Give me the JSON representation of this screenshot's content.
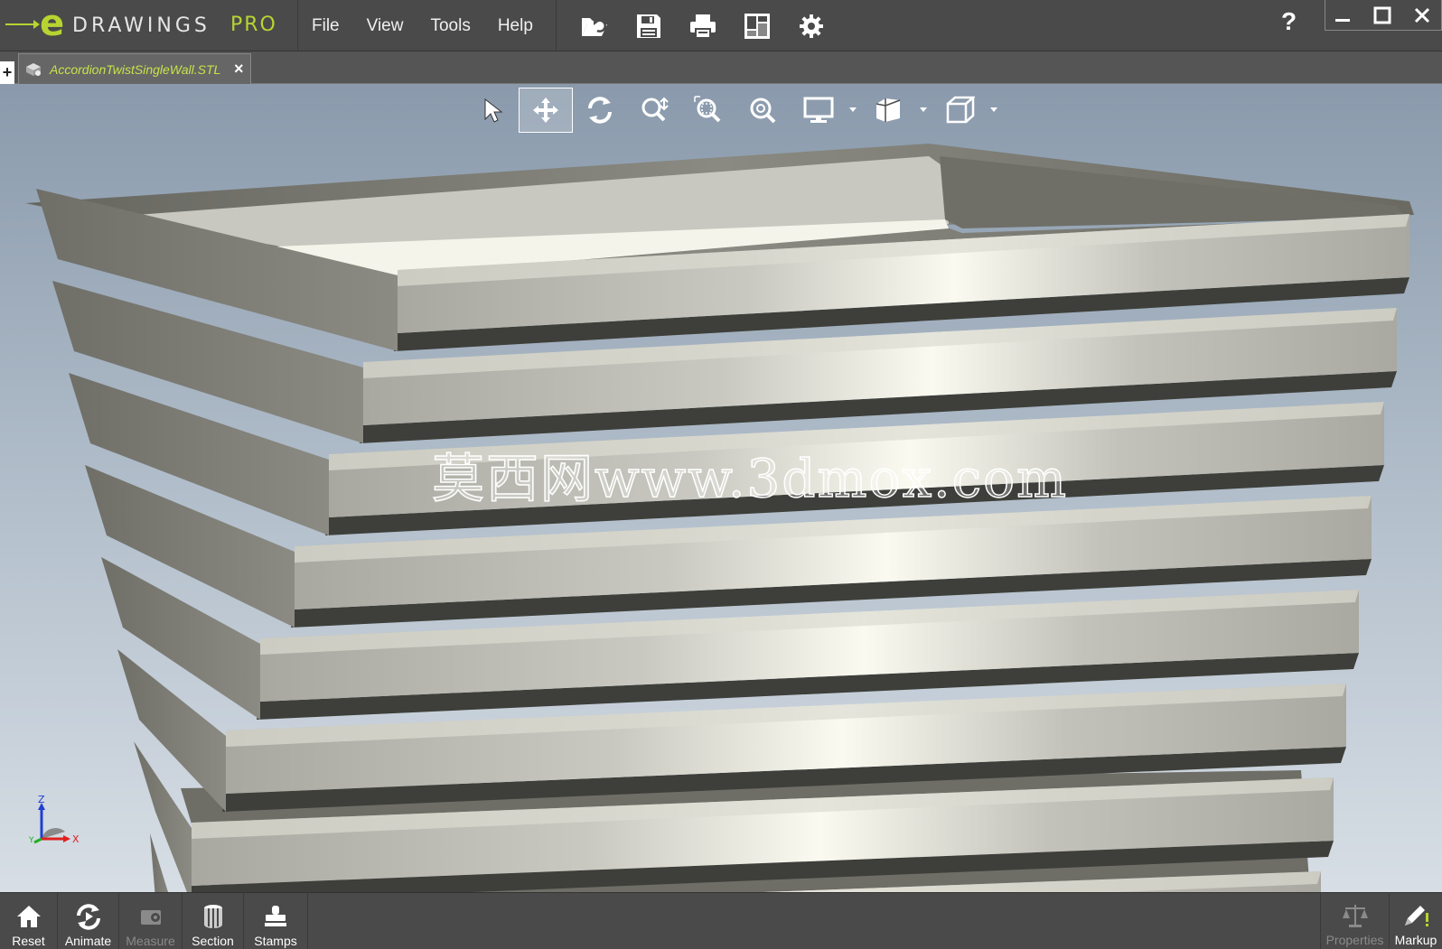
{
  "app": {
    "logo_e": "e",
    "logo_name": "DRAWINGS",
    "logo_pro": "PRO",
    "accent": "#b7d431"
  },
  "menu": [
    "File",
    "View",
    "Tools",
    "Help"
  ],
  "quick_tools": [
    "open-icon",
    "save-icon",
    "print-icon",
    "share-icon",
    "settings-icon"
  ],
  "window": {
    "help": "?",
    "minimize": "—",
    "maximize": "☐",
    "close": "✕"
  },
  "tabs": {
    "new_tab": "+",
    "active": "AccordionTwistSingleWall.STL",
    "close": "×"
  },
  "view_tools": [
    "select-icon",
    "pan-icon",
    "rotate-icon",
    "zoom-fit-icon",
    "zoom-area-icon",
    "zoom-icon",
    "display-icon",
    "display-style-icon",
    "view-orientation-icon"
  ],
  "watermark": "莫西网www.3dmox.com",
  "triad": {
    "z": "Z",
    "x": "X",
    "y": "Y"
  },
  "bottom": {
    "reset": "Reset",
    "animate": "Animate",
    "measure": "Measure",
    "section": "Section",
    "stamps": "Stamps",
    "properties": "Properties",
    "markup": "Markup"
  }
}
